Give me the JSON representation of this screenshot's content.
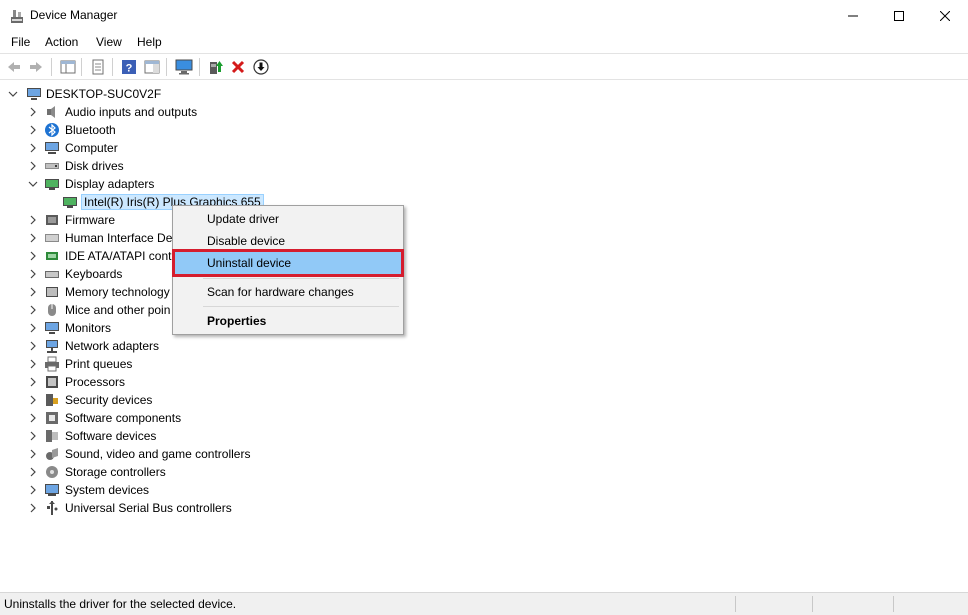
{
  "window": {
    "title": "Device Manager"
  },
  "menu": [
    "File",
    "Action",
    "View",
    "Help"
  ],
  "tree": {
    "root": "DESKTOP-SUC0V2F",
    "categories": [
      {
        "label": "Audio inputs and outputs",
        "icon": "speaker-icon",
        "expanded": false
      },
      {
        "label": "Bluetooth",
        "icon": "bluetooth-icon",
        "expanded": false
      },
      {
        "label": "Computer",
        "icon": "computer-icon",
        "expanded": false
      },
      {
        "label": "Disk drives",
        "icon": "disk-drive-icon",
        "expanded": false
      },
      {
        "label": "Display adapters",
        "icon": "display-adapter-icon",
        "expanded": true
      },
      {
        "label": "Firmware",
        "icon": "firmware-icon",
        "expanded": false
      },
      {
        "label": "Human Interface Dev",
        "icon": "hid-icon",
        "expanded": false
      },
      {
        "label": "IDE ATA/ATAPI contr",
        "icon": "ide-controller-icon",
        "expanded": false
      },
      {
        "label": "Keyboards",
        "icon": "keyboard-icon",
        "expanded": false
      },
      {
        "label": "Memory technology",
        "icon": "memory-icon",
        "expanded": false
      },
      {
        "label": "Mice and other poin",
        "icon": "mouse-icon",
        "expanded": false
      },
      {
        "label": "Monitors",
        "icon": "monitor-icon",
        "expanded": false
      },
      {
        "label": "Network adapters",
        "icon": "network-adapter-icon",
        "expanded": false
      },
      {
        "label": "Print queues",
        "icon": "printer-icon",
        "expanded": false
      },
      {
        "label": "Processors",
        "icon": "processor-icon",
        "expanded": false
      },
      {
        "label": "Security devices",
        "icon": "security-device-icon",
        "expanded": false
      },
      {
        "label": "Software components",
        "icon": "software-component-icon",
        "expanded": false
      },
      {
        "label": "Software devices",
        "icon": "software-device-icon",
        "expanded": false
      },
      {
        "label": "Sound, video and game controllers",
        "icon": "sound-controller-icon",
        "expanded": false
      },
      {
        "label": "Storage controllers",
        "icon": "storage-controller-icon",
        "expanded": false
      },
      {
        "label": "System devices",
        "icon": "system-device-icon",
        "expanded": false
      },
      {
        "label": "Universal Serial Bus controllers",
        "icon": "usb-icon",
        "expanded": false
      }
    ],
    "display_child": "Intel(R) Iris(R) Plus Graphics 655"
  },
  "context_menu": {
    "items": [
      "Update driver",
      "Disable device",
      "Uninstall device",
      "Scan for hardware changes",
      "Properties"
    ],
    "highlighted": "Uninstall device",
    "highlight_color": "#91c9f7",
    "annotation_color": "#d51d2e"
  },
  "status": {
    "text": "Uninstalls the driver for the selected device."
  }
}
